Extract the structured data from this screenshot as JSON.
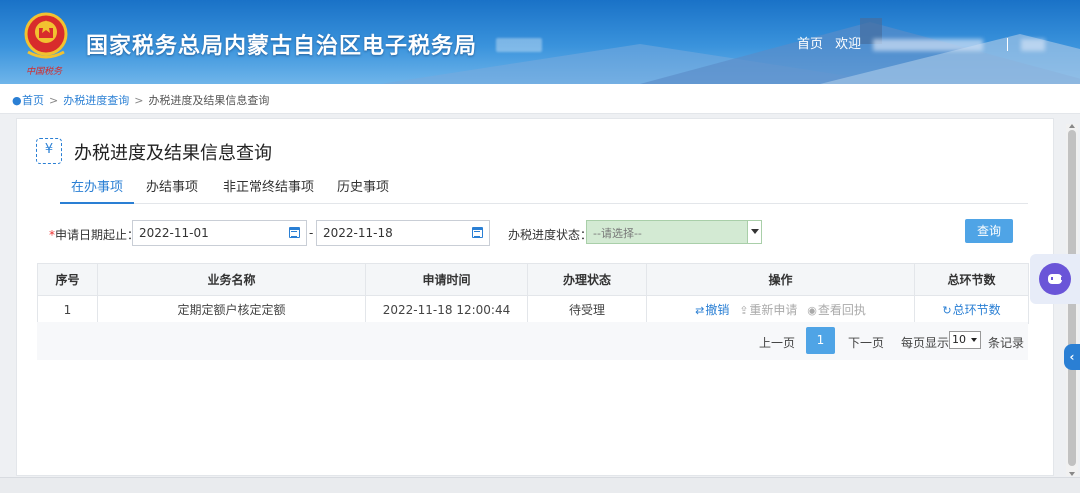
{
  "header": {
    "site_title": "国家税务总局内蒙古自治区电子税务局",
    "seal_text": "中国税务",
    "nav_home": "首页",
    "nav_welcome": "欢迎"
  },
  "breadcrumb": {
    "home": "首页",
    "section": "办税进度查询",
    "current": "办税进度及结果信息查询",
    "sep": ">"
  },
  "page": {
    "icon_glyph": "¥",
    "title": "办税进度及结果信息查询"
  },
  "tabs": [
    {
      "label": "在办事项",
      "active": true
    },
    {
      "label": "办结事项",
      "active": false
    },
    {
      "label": "非正常终结事项",
      "active": false
    },
    {
      "label": "历史事项",
      "active": false
    }
  ],
  "filter": {
    "date_label_req": "*",
    "date_label": "申请日期起止：",
    "start_date": "2022-11-01",
    "dash": "-",
    "end_date": "2022-11-18",
    "status_label": "办税进度状态：",
    "status_value": "--请选择--",
    "query_button": "查询"
  },
  "table": {
    "headers": [
      "序号",
      "业务名称",
      "申请时间",
      "办理状态",
      "操作",
      "总环节数"
    ],
    "rows": [
      {
        "index": "1",
        "name": "定期定额户核定定额",
        "time": "2022-11-18 12:00:44",
        "status": "待受理",
        "op_revoke": "撤销",
        "op_reapply": "重新申请",
        "op_receipt": "查看回执",
        "steps": "总环节数"
      }
    ]
  },
  "pager": {
    "prev": "上一页",
    "current": "1",
    "next": "下一页",
    "per_page_label": "每页显示",
    "per_page": "10",
    "records": "条记录"
  },
  "colors": {
    "primary": "#2a7fd4",
    "button": "#4fa4e6",
    "select_bg": "#d3ead3"
  }
}
